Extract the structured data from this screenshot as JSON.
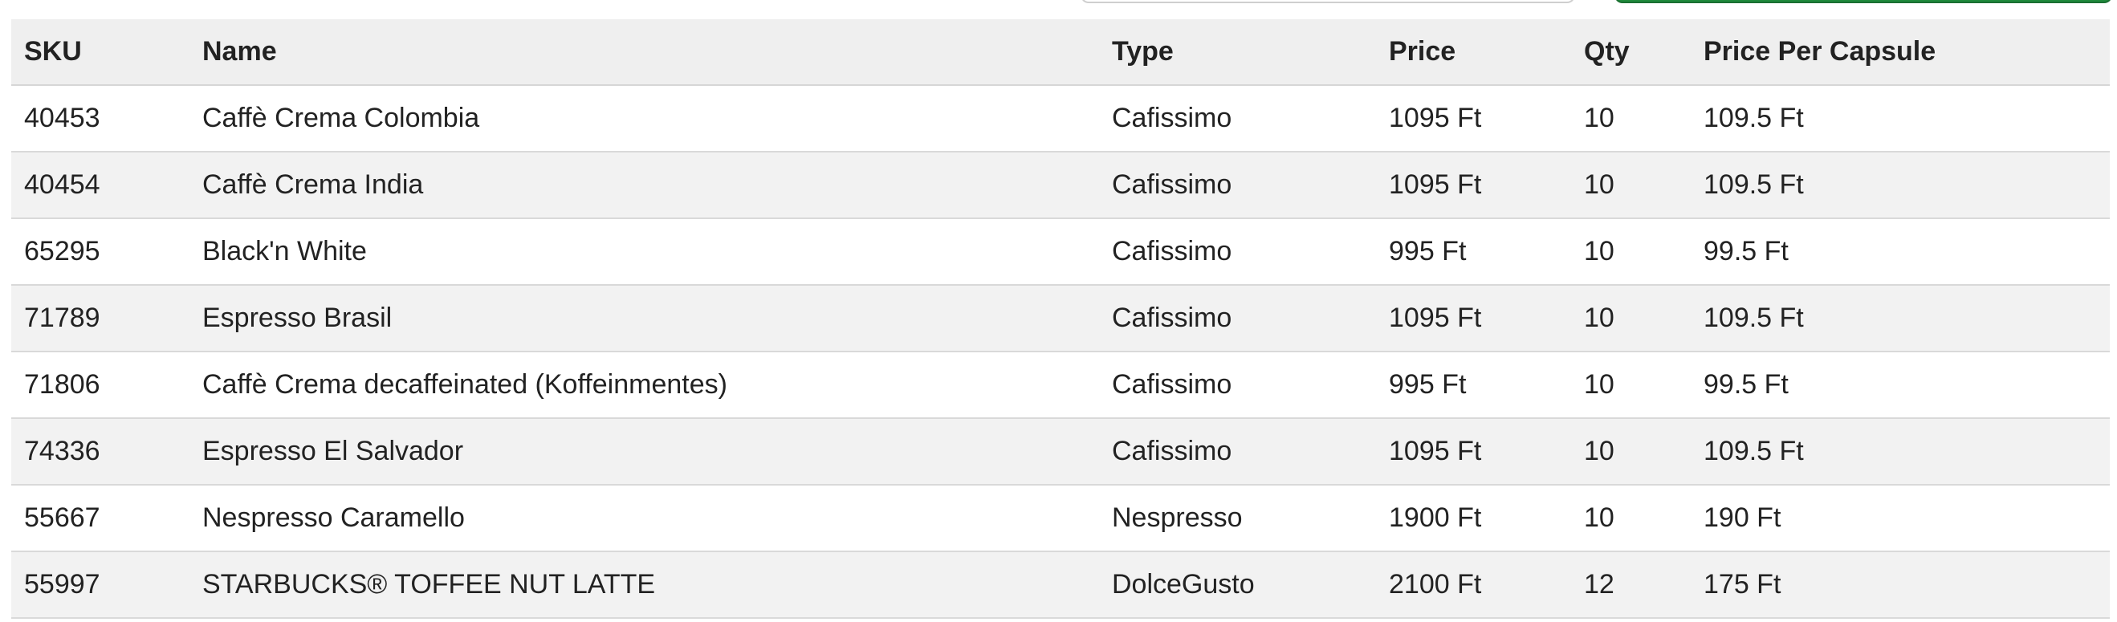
{
  "table": {
    "headers": [
      "SKU",
      "Name",
      "Type",
      "Price",
      "Qty",
      "Price Per Capsule"
    ],
    "rows": [
      [
        "40453",
        "Caffè Crema Colombia",
        "Cafissimo",
        "1095 Ft",
        "10",
        "109.5 Ft"
      ],
      [
        "40454",
        "Caffè Crema India",
        "Cafissimo",
        "1095 Ft",
        "10",
        "109.5 Ft"
      ],
      [
        "65295",
        "Black'n White",
        "Cafissimo",
        "995 Ft",
        "10",
        "99.5 Ft"
      ],
      [
        "71789",
        "Espresso Brasil",
        "Cafissimo",
        "1095 Ft",
        "10",
        "109.5 Ft"
      ],
      [
        "71806",
        "Caffè Crema decaffeinated (Koffeinmentes)",
        "Cafissimo",
        "995 Ft",
        "10",
        "99.5 Ft"
      ],
      [
        "74336",
        "Espresso El Salvador",
        "Cafissimo",
        "1095 Ft",
        "10",
        "109.5 Ft"
      ],
      [
        "55667",
        "Nespresso Caramello",
        "Nespresso",
        "1900 Ft",
        "10",
        "190 Ft"
      ],
      [
        "55997",
        "STARBUCKS® TOFFEE NUT LATTE",
        "DolceGusto",
        "2100 Ft",
        "12",
        "175 Ft"
      ]
    ]
  },
  "colors": {
    "header_bg": "#efefef",
    "stripe_bg": "#f2f2f2",
    "accent_green": "#1f8a3b"
  }
}
